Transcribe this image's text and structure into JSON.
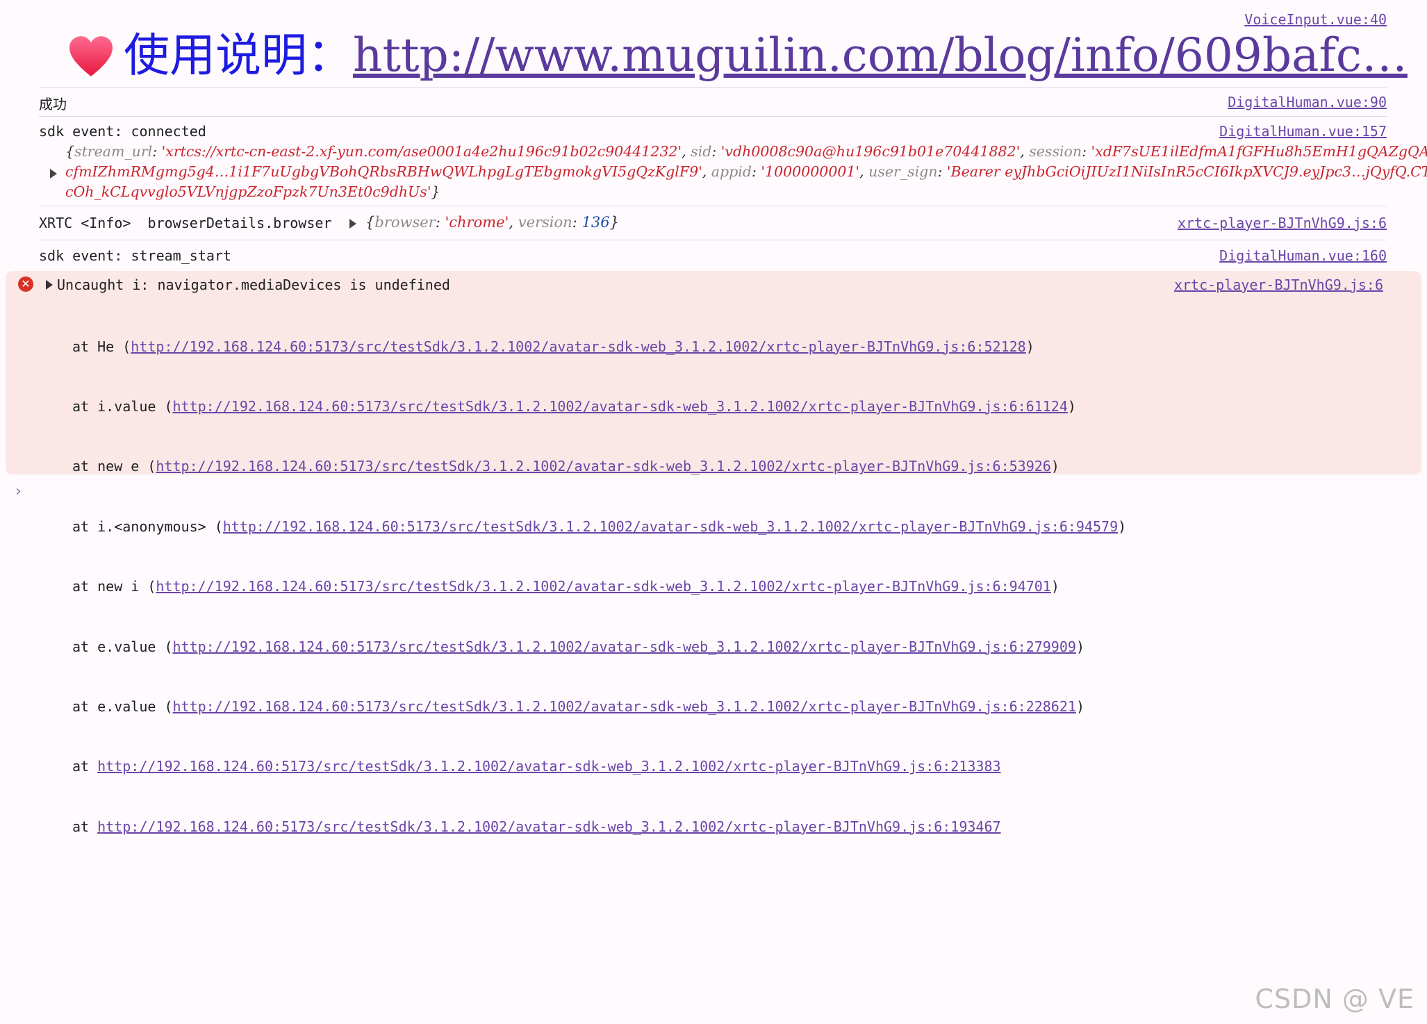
{
  "log1": {
    "source": "VoiceInput.vue:40",
    "label": "使用说明：",
    "link": "http://www.muguilin.com/blog/info/609bafc…"
  },
  "log2": {
    "message": "成功",
    "source": "DigitalHuman.vue:90"
  },
  "log3": {
    "message": "sdk event: connected",
    "source": "DigitalHuman.vue:157",
    "object": [
      {
        "key": "stream_url",
        "value": "'xrtcs://xrtc-cn-east-2.xf-yun.com/ase0001a4e2hu196c91b02c90441232'"
      },
      {
        "key": "sid",
        "value": "'vdh0008c90a@hu196c91b01e70441882'"
      },
      {
        "key": "session",
        "value": "'xdF7sUE1ilEdfmA1fGFHu8h5EmH1gQAZgQAcfmIZhmRMgmg5g4…1i1F7uUgbgVBohQRbsRBHwQWLhpgLgTEbgmokgVI5gQzKglF9'"
      },
      {
        "key": "appid",
        "value": "'1000000001'"
      },
      {
        "key": "user_sign",
        "value": "'Bearer eyJhbGciOiJIUzI1NiIsInR5cCI6IkpXVCJ9.eyJpc3…jQyfQ.CTcOh_kCLqvvglo5VLVnjgpZzoFpzk7Un3Et0c9dhUs'"
      }
    ]
  },
  "log4": {
    "message": "XRTC <Info>  browserDetails.browser",
    "source": "xrtc-player-BJTnVhG9.js:6",
    "object": [
      {
        "key": "browser",
        "value": "'chrome'",
        "type": "string"
      },
      {
        "key": "version",
        "value": "136",
        "type": "number"
      }
    ]
  },
  "log5": {
    "message": "sdk event: stream_start",
    "source": "DigitalHuman.vue:160"
  },
  "error": {
    "icon": "error-circle-icon",
    "message": "Uncaught i: navigator.mediaDevices is undefined",
    "source": "xrtc-player-BJTnVhG9.js:6",
    "stack": [
      {
        "prefix": "at He (",
        "url": "http://192.168.124.60:5173/src/testSdk/3.1.2.1002/avatar-sdk-web_3.1.2.1002/xrtc-player-BJTnVhG9.js:6:52128",
        "suffix": ")"
      },
      {
        "prefix": "at i.value (",
        "url": "http://192.168.124.60:5173/src/testSdk/3.1.2.1002/avatar-sdk-web_3.1.2.1002/xrtc-player-BJTnVhG9.js:6:61124",
        "suffix": ")"
      },
      {
        "prefix": "at new e (",
        "url": "http://192.168.124.60:5173/src/testSdk/3.1.2.1002/avatar-sdk-web_3.1.2.1002/xrtc-player-BJTnVhG9.js:6:53926",
        "suffix": ")"
      },
      {
        "prefix": "at i.<anonymous> (",
        "url": "http://192.168.124.60:5173/src/testSdk/3.1.2.1002/avatar-sdk-web_3.1.2.1002/xrtc-player-BJTnVhG9.js:6:94579",
        "suffix": ")"
      },
      {
        "prefix": "at new i (",
        "url": "http://192.168.124.60:5173/src/testSdk/3.1.2.1002/avatar-sdk-web_3.1.2.1002/xrtc-player-BJTnVhG9.js:6:94701",
        "suffix": ")"
      },
      {
        "prefix": "at e.value (",
        "url": "http://192.168.124.60:5173/src/testSdk/3.1.2.1002/avatar-sdk-web_3.1.2.1002/xrtc-player-BJTnVhG9.js:6:279909",
        "suffix": ")"
      },
      {
        "prefix": "at e.value (",
        "url": "http://192.168.124.60:5173/src/testSdk/3.1.2.1002/avatar-sdk-web_3.1.2.1002/xrtc-player-BJTnVhG9.js:6:228621",
        "suffix": ")"
      },
      {
        "prefix": "at ",
        "url": "http://192.168.124.60:5173/src/testSdk/3.1.2.1002/avatar-sdk-web_3.1.2.1002/xrtc-player-BJTnVhG9.js:6:213383",
        "suffix": ""
      },
      {
        "prefix": "at ",
        "url": "http://192.168.124.60:5173/src/testSdk/3.1.2.1002/avatar-sdk-web_3.1.2.1002/xrtc-player-BJTnVhG9.js:6:193467",
        "suffix": ""
      }
    ]
  },
  "prompt": {
    "glyph": "›",
    "icon": "chevron-right-icon"
  },
  "watermark": "CSDN @ VE",
  "colors": {
    "error_bg": "#fbe8e6",
    "link": "#6b45a8",
    "string": "#c8262f",
    "number": "#1a4fa3",
    "label_blue": "#1d1be0"
  }
}
